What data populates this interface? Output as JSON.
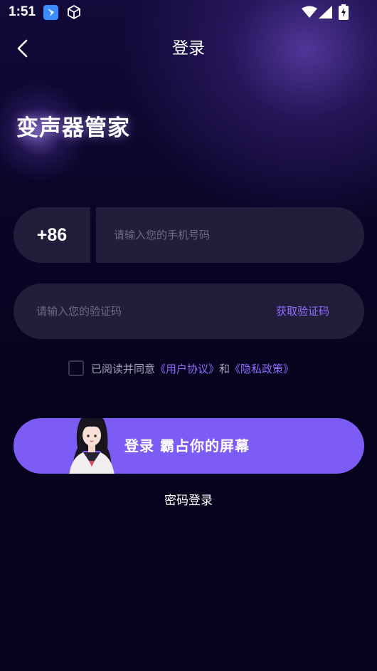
{
  "status_bar": {
    "time": "1:51"
  },
  "header": {
    "title": "登录"
  },
  "brand": {
    "app_name": "变声器管家"
  },
  "phone": {
    "country_code": "+86",
    "placeholder": "请输入您的手机号码",
    "value": ""
  },
  "code": {
    "placeholder": "请输入您的验证码",
    "value": "",
    "get_code_label": "获取验证码"
  },
  "agreement": {
    "checked": false,
    "prefix": "已阅读并同意",
    "user_agreement": "《用户协议》",
    "conjunction": "和",
    "privacy_policy": "《隐私政策》"
  },
  "login": {
    "button_label": "登录 霸占你的屏幕"
  },
  "alt_login": {
    "password_login_label": "密码登录"
  },
  "colors": {
    "accent": "#7c5cf5",
    "link": "#8f6cff",
    "field_bg": "#221d3a",
    "background": "#07031f"
  }
}
